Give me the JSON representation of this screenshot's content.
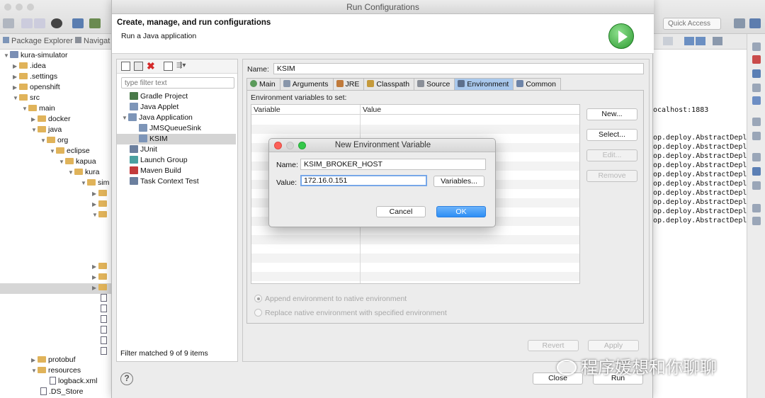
{
  "background": {
    "quick_access_placeholder": "Quick Access",
    "left_tabs": [
      "Package Explorer",
      "Navigat"
    ],
    "tree": [
      {
        "label": "kura-simulator",
        "icon": "project-icon"
      },
      {
        "label": ".idea",
        "icon": "folder-icon"
      },
      {
        "label": ".settings",
        "icon": "folder-icon"
      },
      {
        "label": "openshift",
        "icon": "folder-icon"
      },
      {
        "label": "src",
        "icon": "folder-icon"
      },
      {
        "label": "main",
        "icon": "folder-icon"
      },
      {
        "label": "docker",
        "icon": "folder-icon"
      },
      {
        "label": "java",
        "icon": "folder-icon"
      },
      {
        "label": "org",
        "icon": "folder-icon"
      },
      {
        "label": "eclipse",
        "icon": "folder-icon"
      },
      {
        "label": "kapua",
        "icon": "folder-icon"
      },
      {
        "label": "kura",
        "icon": "folder-icon"
      },
      {
        "label": "sim",
        "icon": "folder-icon"
      }
    ],
    "tree_bottom": [
      {
        "label": "protobuf",
        "icon": "folder-icon"
      },
      {
        "label": "resources",
        "icon": "folder-icon"
      },
      {
        "label": "logback.xml",
        "icon": "file-icon"
      },
      {
        "label": ".DS_Store",
        "icon": "file-icon"
      }
    ],
    "console_lines": [
      "ocalhost:1883",
      "op.deploy.AbstractDeplo",
      "op.deploy.AbstractDeplo",
      "op.deploy.AbstractDeplo",
      "op.deploy.AbstractDeplo",
      "op.deploy.AbstractDeplo",
      "op.deploy.AbstractDeplo",
      "op.deploy.AbstractDeplo",
      "op.deploy.AbstractDeplo",
      "op.deploy.AbstractDeplo",
      "op.deploy.AbstractDeplo"
    ]
  },
  "dialog": {
    "title": "Run Configurations",
    "header_title": "Create, manage, and run configurations",
    "header_subtitle": "Run a Java application",
    "filter_placeholder": "type filter text",
    "config_tree": [
      {
        "label": "Gradle Project",
        "icon": "gradle-icon",
        "color": "#4a7a4a"
      },
      {
        "label": "Java Applet",
        "icon": "applet-icon",
        "color": "#7d95b8"
      },
      {
        "label": "Java Application",
        "icon": "java-app-icon",
        "color": "#7d95b8"
      },
      {
        "label": "JMSQueueSink",
        "icon": "java-app-icon",
        "color": "#7d95b8"
      },
      {
        "label": "KSIM",
        "icon": "java-app-icon",
        "color": "#7d95b8",
        "selected": true
      },
      {
        "label": "JUnit",
        "icon": "junit-icon",
        "color": "#6b7f9e"
      },
      {
        "label": "Launch Group",
        "icon": "launch-group-icon",
        "color": "#4aa0a0"
      },
      {
        "label": "Maven Build",
        "icon": "maven-icon",
        "color": "#c33b3b"
      },
      {
        "label": "Task Context Test",
        "icon": "junit-icon",
        "color": "#6b7f9e"
      }
    ],
    "filter_status": "Filter matched 9 of 9 items",
    "name_label": "Name:",
    "name_value": "KSIM",
    "tabs": [
      {
        "label": "Main",
        "icon": "main-icon"
      },
      {
        "label": "Arguments",
        "icon": "arguments-icon"
      },
      {
        "label": "JRE",
        "icon": "jre-icon"
      },
      {
        "label": "Classpath",
        "icon": "classpath-icon"
      },
      {
        "label": "Source",
        "icon": "source-icon"
      },
      {
        "label": "Environment",
        "icon": "environment-icon",
        "active": true
      },
      {
        "label": "Common",
        "icon": "common-icon"
      }
    ],
    "env_label": "Environment variables to set:",
    "columns": [
      "Variable",
      "Value"
    ],
    "side_buttons": [
      {
        "label": "New...",
        "enabled": true
      },
      {
        "label": "Select...",
        "enabled": true
      },
      {
        "label": "Edit...",
        "enabled": false
      },
      {
        "label": "Remove",
        "enabled": false
      }
    ],
    "radio_append": "Append environment to native environment",
    "radio_replace": "Replace native environment with specified environment",
    "revert_label": "Revert",
    "apply_label": "Apply",
    "close_label": "Close",
    "run_label": "Run",
    "help_glyph": "?"
  },
  "new_env_dialog": {
    "title": "New Environment Variable",
    "name_label": "Name:",
    "name_value": "KSIM_BROKER_HOST",
    "value_label": "Value:",
    "value_value": "172.16.0.151",
    "variables_label": "Variables...",
    "cancel_label": "Cancel",
    "ok_label": "OK"
  },
  "watermark": "程序媛想和你聊聊"
}
